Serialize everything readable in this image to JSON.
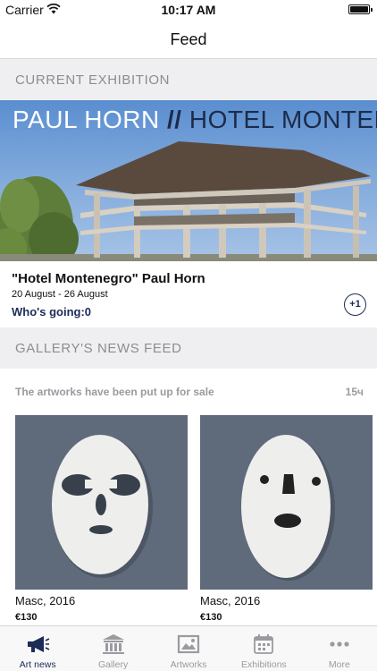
{
  "status_bar": {
    "carrier": "Carrier",
    "time": "10:17 AM",
    "icons": [
      "wifi-icon",
      "battery-icon"
    ]
  },
  "nav": {
    "title": "Feed"
  },
  "current_exhibition": {
    "section_label": "CURRENT EXHIBITION",
    "banner_text_artist": "PAUL HORN",
    "banner_text_separator": "//",
    "banner_text_title": "HOTEL MONTENE",
    "title": "\"Hotel Montenegro\" Paul Horn",
    "dates": "20 August - 26 August",
    "going": "Who's going:0",
    "plus_label": "+1"
  },
  "news_feed": {
    "section_label": "GALLERY'S NEWS FEED",
    "item_text": "The artworks have been put up for sale",
    "item_time": "15ч",
    "artworks": [
      {
        "title": "Masc, 2016",
        "price": "€130"
      },
      {
        "title": "Masc, 2016",
        "price": "€130"
      }
    ]
  },
  "tabs": [
    {
      "label": "Art news",
      "icon": "megaphone-icon",
      "active": true
    },
    {
      "label": "Gallery",
      "icon": "museum-icon",
      "active": false
    },
    {
      "label": "Artworks",
      "icon": "picture-icon",
      "active": false
    },
    {
      "label": "Exhibitions",
      "icon": "calendar-icon",
      "active": false
    },
    {
      "label": "More",
      "icon": "more-dots-icon",
      "active": false
    }
  ],
  "colors": {
    "accent": "#1d2b57",
    "section_bg": "#efeff1",
    "section_text": "#8c8c93",
    "inactive_tab": "#9a9aa0"
  }
}
